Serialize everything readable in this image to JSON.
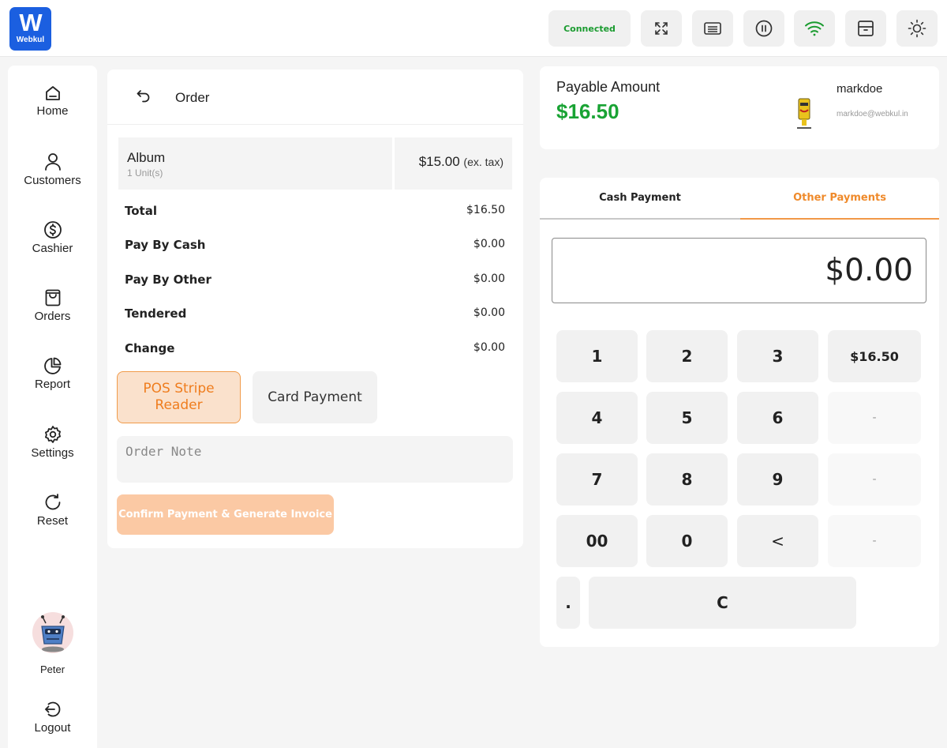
{
  "topbar": {
    "logo_text": "Webkul",
    "connection_status": "Connected",
    "icons": [
      "fullscreen-icon",
      "keyboard-icon",
      "pause-icon",
      "wifi-icon",
      "drawer-icon",
      "brightness-icon"
    ],
    "status_color": "#1a9b2f"
  },
  "sidebar": {
    "items": [
      {
        "label": "Home",
        "icon": "home-icon"
      },
      {
        "label": "Customers",
        "icon": "user-icon"
      },
      {
        "label": "Cashier",
        "icon": "dollar-icon"
      },
      {
        "label": "Orders",
        "icon": "bag-icon"
      },
      {
        "label": "Report",
        "icon": "pie-chart-icon"
      },
      {
        "label": "Settings",
        "icon": "gear-icon"
      },
      {
        "label": "Reset",
        "icon": "refresh-icon"
      }
    ],
    "user_name": "Peter",
    "logout_label": "Logout"
  },
  "order": {
    "title": "Order",
    "item": {
      "name": "Album",
      "units": "1 Unit(s)",
      "price": "$15.00",
      "tax_note": "(ex. tax)"
    },
    "summary": [
      {
        "label": "Total",
        "value": "$16.50"
      },
      {
        "label": "Pay By Cash",
        "value": "$0.00"
      },
      {
        "label": "Pay By Other",
        "value": "$0.00"
      },
      {
        "label": "Tendered",
        "value": "$0.00"
      },
      {
        "label": "Change",
        "value": "$0.00"
      }
    ],
    "payment_methods": {
      "stripe": "POS Stripe Reader",
      "card": "Card Payment"
    },
    "note_placeholder": "Order Note",
    "confirm_label": "Confirm Payment & Generate Invoice"
  },
  "payable": {
    "label": "Payable Amount",
    "amount": "$16.50",
    "amount_color": "#19a334",
    "customer_name": "markdoe",
    "customer_email": "markdoe@webkul.in"
  },
  "payment": {
    "tabs": {
      "cash": "Cash Payment",
      "other": "Other Payments"
    },
    "accent_color": "#ef8a2b",
    "display_value": "$0.00",
    "keypad": {
      "k1": "1",
      "k2": "2",
      "k3": "3",
      "quick": "$16.50",
      "k4": "4",
      "k5": "5",
      "k6": "6",
      "blank1": "-",
      "k7": "7",
      "k8": "8",
      "k9": "9",
      "blank2": "-",
      "k00": "00",
      "k0": "0",
      "back": "<",
      "blank3": "-",
      "dot": ".",
      "clear": "C"
    }
  }
}
